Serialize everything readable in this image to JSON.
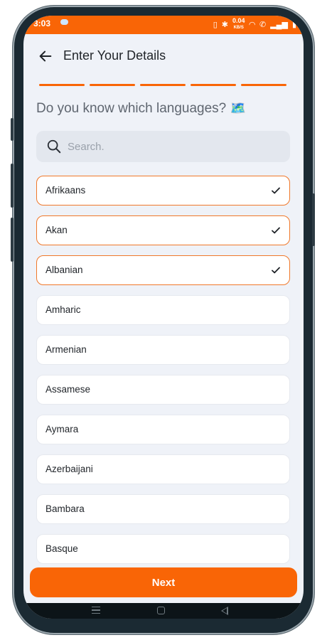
{
  "status_bar": {
    "time": "3:03",
    "network_speed": "0.04",
    "network_unit": "KB/S"
  },
  "header": {
    "title": "Enter Your Details",
    "back_icon": "arrow-left-icon"
  },
  "progress": {
    "total_steps": 5,
    "completed_steps": 5,
    "accent_color": "#f96506"
  },
  "question": {
    "text": "Do you know which languages?",
    "emoji": "🗺️"
  },
  "search": {
    "placeholder": "Search.",
    "value": ""
  },
  "languages": [
    {
      "label": "Afrikaans",
      "selected": true
    },
    {
      "label": "Akan",
      "selected": true
    },
    {
      "label": "Albanian",
      "selected": true
    },
    {
      "label": "Amharic",
      "selected": false
    },
    {
      "label": "Armenian",
      "selected": false
    },
    {
      "label": "Assamese",
      "selected": false
    },
    {
      "label": "Aymara",
      "selected": false
    },
    {
      "label": "Azerbaijani",
      "selected": false
    },
    {
      "label": "Bambara",
      "selected": false
    },
    {
      "label": "Basque",
      "selected": false
    }
  ],
  "footer": {
    "next_label": "Next",
    "button_color": "#f96506"
  },
  "colors": {
    "accent": "#f96506",
    "background": "#eff2f8",
    "selected_border": "#f0782a"
  }
}
